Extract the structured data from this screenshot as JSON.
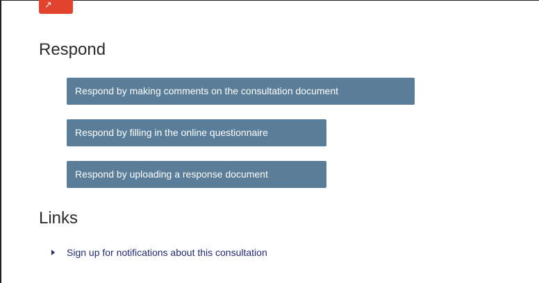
{
  "header": {
    "badge_color": "#e1432e",
    "badge_icon": "share-icon",
    "badge_glyph": "↗"
  },
  "respond": {
    "heading": "Respond",
    "buttons": [
      {
        "label": "Respond by making comments on the consultation document"
      },
      {
        "label": "Respond by filling in the online questionnaire"
      },
      {
        "label": "Respond by uploading a response document"
      }
    ],
    "button_color": "#5a7e99"
  },
  "links": {
    "heading": "Links",
    "items": [
      {
        "label": "Sign up for notifications about this consultation",
        "icon": "triangle-bullet-icon"
      }
    ],
    "link_color": "#1f2a73"
  }
}
